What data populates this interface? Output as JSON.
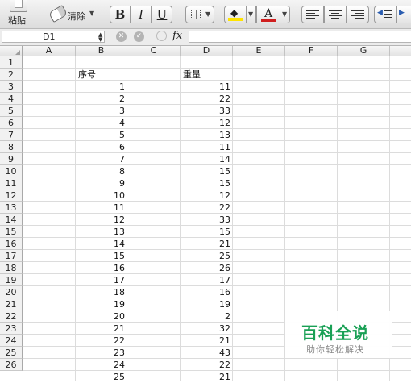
{
  "ribbon": {
    "paste_label": "粘贴",
    "clear_label": "清除",
    "bold_label": "B",
    "italic_label": "I",
    "underline_label": "U",
    "font_color_label": "A",
    "fill_color": "#ffe400",
    "font_color": "#d01f1f"
  },
  "formula_bar": {
    "name_box": "D1",
    "fx_label": "fx",
    "formula": ""
  },
  "sheet": {
    "columns": [
      "A",
      "B",
      "C",
      "D",
      "E",
      "F",
      "G"
    ],
    "rows": [
      "1",
      "2",
      "3",
      "4",
      "5",
      "6",
      "7",
      "8",
      "9",
      "10",
      "11",
      "12",
      "13",
      "14",
      "15",
      "16",
      "17",
      "18",
      "19",
      "20",
      "21",
      "22",
      "23",
      "24",
      "25",
      "26"
    ],
    "header_b": "序号",
    "header_d": "重量",
    "b_values": [
      "1",
      "2",
      "3",
      "4",
      "5",
      "6",
      "7",
      "8",
      "9",
      "10",
      "11",
      "12",
      "13",
      "14",
      "15",
      "16",
      "17",
      "18",
      "19",
      "20",
      "21",
      "22",
      "23",
      "24",
      "25"
    ],
    "d_values": [
      "11",
      "22",
      "33",
      "12",
      "13",
      "11",
      "14",
      "15",
      "15",
      "12",
      "22",
      "33",
      "15",
      "21",
      "25",
      "26",
      "17",
      "16",
      "19",
      "2",
      "32",
      "21",
      "43",
      "22",
      "21"
    ]
  },
  "watermark": {
    "title": "百科全说",
    "subtitle": "助你轻松解决"
  }
}
